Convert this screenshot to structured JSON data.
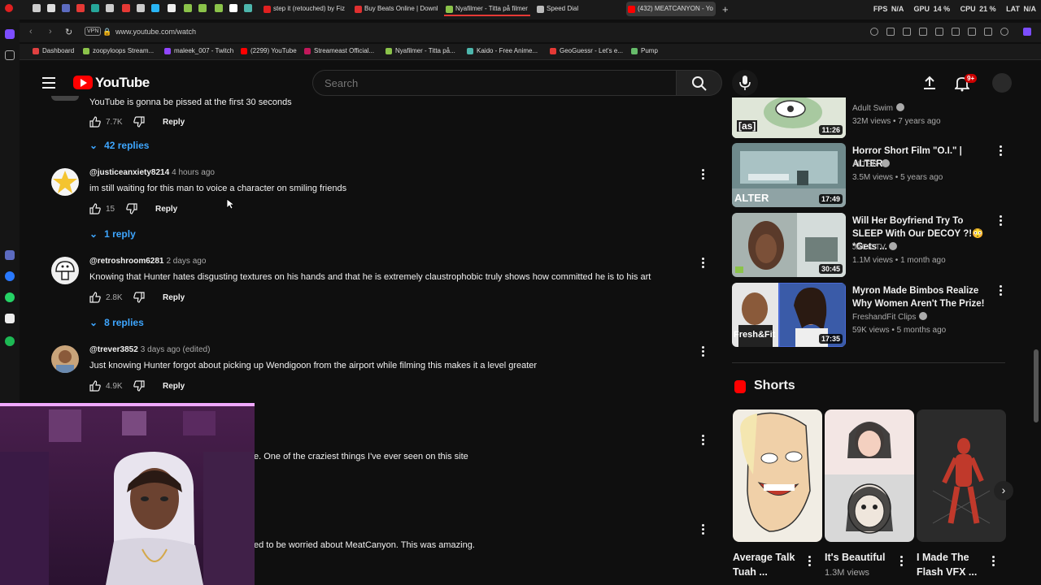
{
  "browser": {
    "tabs": [
      {
        "label": "step it (retouched) by Fiz",
        "color": "#e02020"
      },
      {
        "label": "Buy Beats Online | Downl",
        "color": "#e03030"
      },
      {
        "label": "Nyafilmer - Titta på filmer",
        "color": "#8bc34a"
      },
      {
        "label": "Speed Dial",
        "color": "#bbbbbb"
      },
      {
        "label": "(432) MEATCANYON - Yo",
        "color": "#ff0000"
      }
    ],
    "sysinfo": {
      "fps_label": "FPS",
      "fps": "N/A",
      "gpu_label": "GPU",
      "gpu": "14 %",
      "cpu_label": "CPU",
      "cpu": "21 %",
      "lat_label": "LAT",
      "lat": "N/A"
    },
    "vpn_label": "VPN",
    "url": "www.youtube.com/watch",
    "bookmarks": [
      {
        "label": "Dashboard",
        "color": "#e04040"
      },
      {
        "label": "zoopyloops Stream...",
        "color": "#8bc34a"
      },
      {
        "label": "maleek_007 - Twitch",
        "color": "#9146ff"
      },
      {
        "label": "(2299) YouTube",
        "color": "#ff0000"
      },
      {
        "label": "Streameast Official...",
        "color": "#c2185b"
      },
      {
        "label": "Nyafilmer - Titta på...",
        "color": "#8bc34a"
      },
      {
        "label": "Kaido - Free Anime...",
        "color": "#4db6ac"
      },
      {
        "label": "GeoGuessr - Let's e...",
        "color": "#e53935"
      },
      {
        "label": "Pump",
        "color": "#66bb6a"
      }
    ]
  },
  "youtube": {
    "logo_text": "YouTube",
    "search_placeholder": "Search",
    "notification_badge": "9+"
  },
  "comments": [
    {
      "user": "",
      "time": "",
      "text": "YouTube is gonna be pissed at the first 30 seconds",
      "likes": "7.7K",
      "reply_label": "Reply",
      "replies": "42 replies"
    },
    {
      "user": "@justiceanxiety8214",
      "time": "4 hours ago",
      "text": "im still waiting for this man to voice a character on smiling friends",
      "likes": "15",
      "reply_label": "Reply",
      "replies": "1 reply"
    },
    {
      "user": "@retroshroom6281",
      "time": "2 days ago",
      "text": "Knowing that Hunter hates disgusting textures on his hands and that he is extremely claustrophobic truly shows how committed he is to his art",
      "likes": "2.8K",
      "reply_label": "Reply",
      "replies": "8 replies"
    },
    {
      "user": "@trever3852",
      "time": "3 days ago (edited)",
      "text": "Just knowing Hunter forgot about picking up Wendigoon from the airport while filming this makes it a level greater",
      "likes": "4.9K",
      "reply_label": "Reply",
      "replies": ""
    },
    {
      "user": "",
      "time": "",
      "text": "e. One of the craziest things I've ever seen on this site",
      "likes": "",
      "reply_label": "",
      "replies": ""
    },
    {
      "user": "",
      "time": "",
      "text": "ed to be worried about MeatCanyon. This was amazing.",
      "likes": "",
      "reply_label": "",
      "replies": ""
    }
  ],
  "related_videos": [
    {
      "title": "",
      "channel": "Adult Swim",
      "meta": "32M views • 7 years ago",
      "duration": "11:26",
      "thumb_label": "[as]"
    },
    {
      "title": "Horror Short Film \"O.I.\" | ALTER",
      "channel": "ALTER",
      "meta": "3.5M views • 5 years ago",
      "duration": "17:49",
      "thumb_label": "ALTER"
    },
    {
      "title": "Will Her Boyfriend Try To SLEEP With Our DECOY ?!😳 *Gets ...",
      "channel": "JACK TV",
      "meta": "1.1M views • 1 month ago",
      "duration": "30:45",
      "thumb_label": ""
    },
    {
      "title": "Myron Made Bimbos Realize Why Women Aren't The Prize!",
      "channel": "FreshandFit Clips",
      "meta": "59K views • 5 months ago",
      "duration": "17:35",
      "thumb_label": "Fresh&Fit"
    }
  ],
  "shorts": {
    "heading": "Shorts",
    "items": [
      {
        "title": "Average Talk Tuah ...",
        "views": ""
      },
      {
        "title": "It's Beautiful",
        "views": "1.3M views"
      },
      {
        "title": "I Made The Flash VFX ...",
        "views": ""
      }
    ]
  },
  "colors": {
    "background": "#0f0f0f",
    "link": "#3ea6ff",
    "brand": "#ff0000"
  }
}
